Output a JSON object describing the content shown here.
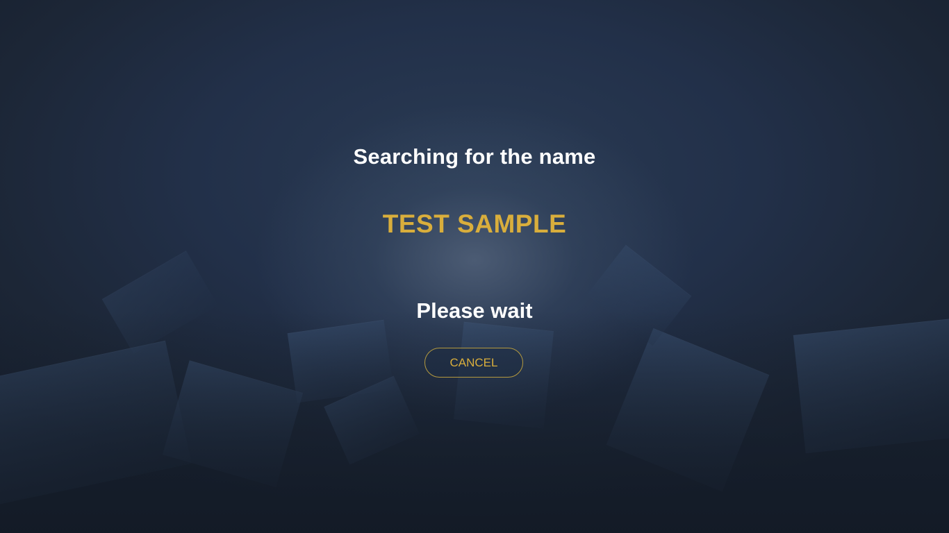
{
  "dialog": {
    "heading": "Searching for the name",
    "search_name": "TEST SAMPLE",
    "status": "Please wait",
    "cancel_label": "CANCEL"
  },
  "colors": {
    "accent": "#d9ae3c",
    "background": "#1f2b3d",
    "text": "#ffffff"
  }
}
